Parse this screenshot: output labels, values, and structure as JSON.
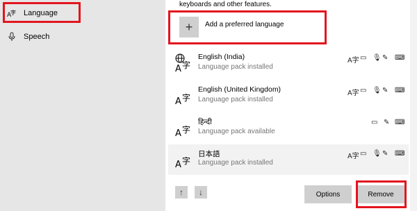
{
  "sidebar": {
    "items": [
      {
        "label": "Language",
        "icon": "language-icon"
      },
      {
        "label": "Speech",
        "icon": "microphone-icon"
      }
    ]
  },
  "main": {
    "intro_text": "keyboards and other features.",
    "add_language_label": "Add a preferred language",
    "languages": [
      {
        "name": "English (India)",
        "status": "Language pack installed"
      },
      {
        "name": "English (United Kingdom)",
        "status": "Language pack installed"
      },
      {
        "name": "हिन्दी",
        "status": "Language pack available"
      },
      {
        "name": "日本語",
        "status": "Language pack installed"
      }
    ],
    "buttons": {
      "options": "Options",
      "remove": "Remove"
    }
  },
  "colors": {
    "highlight_box": "#e3141e",
    "sidebar_bg": "#e6e6e6",
    "button_bg": "#cfcfcf"
  }
}
